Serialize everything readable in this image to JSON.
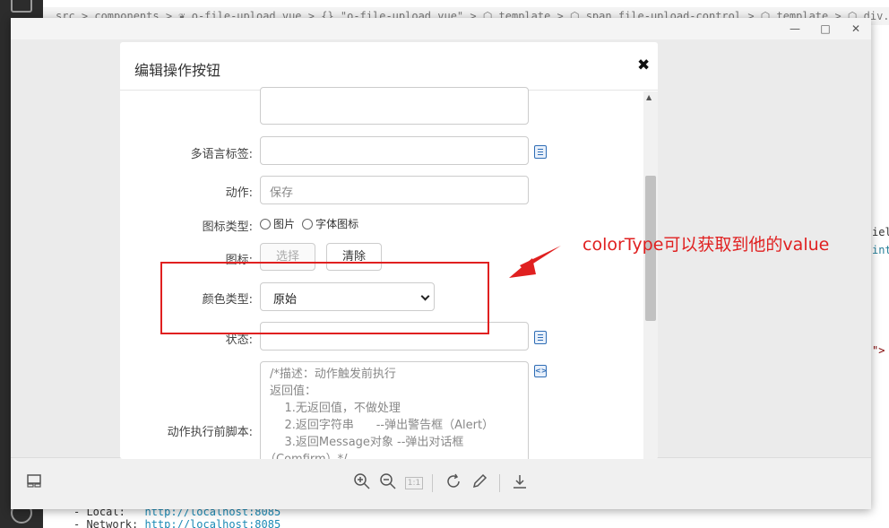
{
  "editor": {
    "breadcrumb": "src > components > ❦ o-file-upload.vue > {} \"o-file-upload.vue\" > ⬡ template > ⬡ span.file-upload-control > ⬡ template > ⬡ div.file-upload-wrap > ⬡ div",
    "terminal": {
      "local_label": "- Local:",
      "local_url": "http://localhost:8085",
      "network_label": "- Network:",
      "network_url": "http://localhost:8085"
    },
    "code_fragments": [
      "iel",
      "int",
      "\">"
    ]
  },
  "viewer": {
    "window_buttons": [
      "—",
      "□",
      "✕"
    ]
  },
  "dialog": {
    "title": "编辑操作按钮",
    "close": "✖",
    "fields": {
      "multilang_label": "多语言标签:",
      "action_label": "动作:",
      "action_value": "保存",
      "icon_type_label": "图标类型:",
      "icon_type_options": [
        "图片",
        "字体图标"
      ],
      "icon_label": "图标:",
      "select_button": "选择",
      "clear_button": "清除",
      "color_type_label": "颜色类型:",
      "color_type_value": "原始",
      "status_label": "状态:",
      "pre_script_label": "动作执行前脚本:",
      "pre_script_lines": [
        "/*描述：动作触发前执行",
        "返回值：",
        "    1.无返回值，不做处理",
        "    2.返回字符串      --弹出警告框（Alert）",
        "    3.返回Message对象 --弹出对话框",
        "（Comfirm）*/"
      ]
    }
  },
  "annotation": {
    "text": "colorType可以获取到他的value",
    "color": "#e02020"
  },
  "icons": {
    "toolbar": [
      "layout-icon",
      "zoom-in-icon",
      "zoom-out-icon",
      "actual-size-icon",
      "rotate-icon",
      "edit-icon",
      "download-icon"
    ],
    "actual_size_label": "1:1"
  }
}
